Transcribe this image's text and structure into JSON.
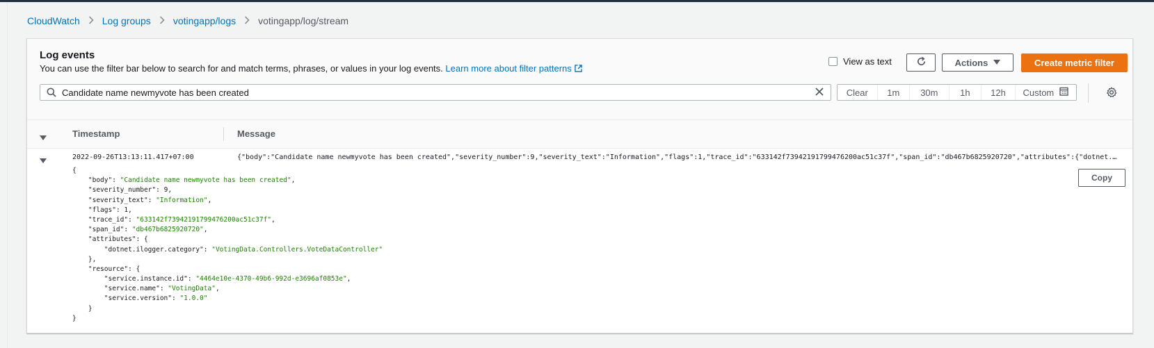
{
  "breadcrumb": [
    {
      "label": "CloudWatch"
    },
    {
      "label": "Log groups"
    },
    {
      "label": "votingapp/logs"
    },
    {
      "label": "votingapp/log/stream"
    }
  ],
  "panel": {
    "title": "Log events",
    "description": "You can use the filter bar below to search for and match terms, phrases, or values in your log events.",
    "learn_more": "Learn more about filter patterns"
  },
  "controls": {
    "view_as_text": "View as text",
    "view_as_text_checked": false,
    "actions_label": "Actions",
    "create_label": "Create metric filter"
  },
  "search": {
    "value": "Candidate name newmyvote has been created"
  },
  "range": {
    "clear": "Clear",
    "opt_1m": "1m",
    "opt_30m": "30m",
    "opt_1h": "1h",
    "opt_12h": "12h",
    "custom": "Custom"
  },
  "table": {
    "col_timestamp": "Timestamp",
    "col_message": "Message"
  },
  "row": {
    "timestamp": "2022-09-26T13:13:11.417+07:00",
    "message": "{\"body\":\"Candidate name newmyvote has been created\",\"severity_number\":9,\"severity_text\":\"Information\",\"flags\":1,\"trace_id\":\"633142f73942191799476200ac51c37f\",\"span_id\":\"db467b6825920720\",\"attributes\":{\"dotnet.ilogger.category\":\"VotingData.Controllers.VoteDataController\"},\"resource\":{\"service.instance.id\":\"4464e10e-4370-49b6-992d-e3696af0853e\",\"service.name\":\"VotingData\",\"service.version\":\"1.0.0\"}}",
    "copy_label": "Copy"
  },
  "json_detail": {
    "body": "\"Candidate name newmyvote has been created\"",
    "severity_number": "9",
    "severity_text": "\"Information\"",
    "flags": "1",
    "trace_id": "\"633142f73942191799476200ac51c37f\"",
    "span_id": "\"db467b6825920720\"",
    "attr_category": "\"VotingData.Controllers.VoteDataController\"",
    "instance_id": "\"4464e10e-4370-49b6-992d-e3696af0853e\"",
    "service_name": "\"VotingData\"",
    "service_version": "\"1.0.0\""
  }
}
